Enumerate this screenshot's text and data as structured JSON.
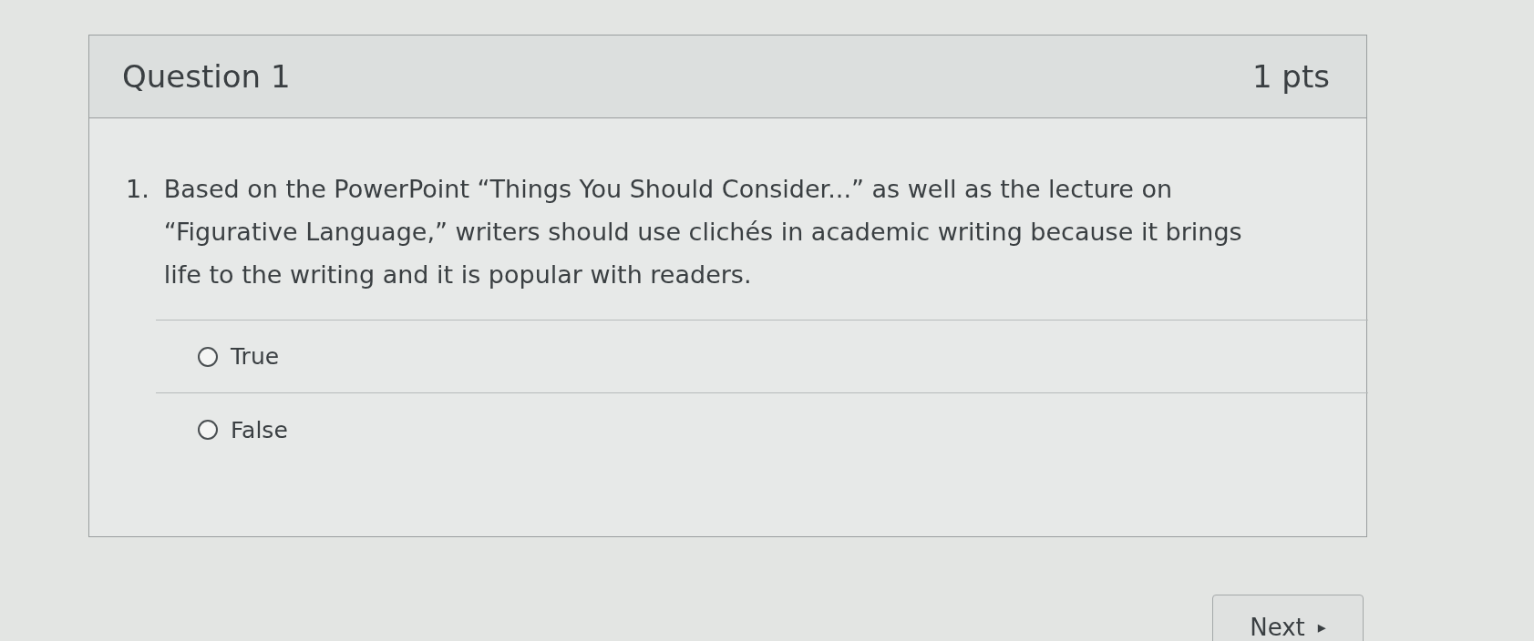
{
  "question": {
    "title": "Question 1",
    "points": "1 pts",
    "number": "1.",
    "text": "Based on the PowerPoint “Things You Should Consider...” as well as the lecture on “Figurative Language,” writers should use clichés in academic writing because it brings life to the writing and it is popular with readers."
  },
  "answers": [
    {
      "label": "True",
      "selected": false
    },
    {
      "label": "False",
      "selected": false
    }
  ],
  "next_button": {
    "label": "Next",
    "arrow": "▸"
  }
}
